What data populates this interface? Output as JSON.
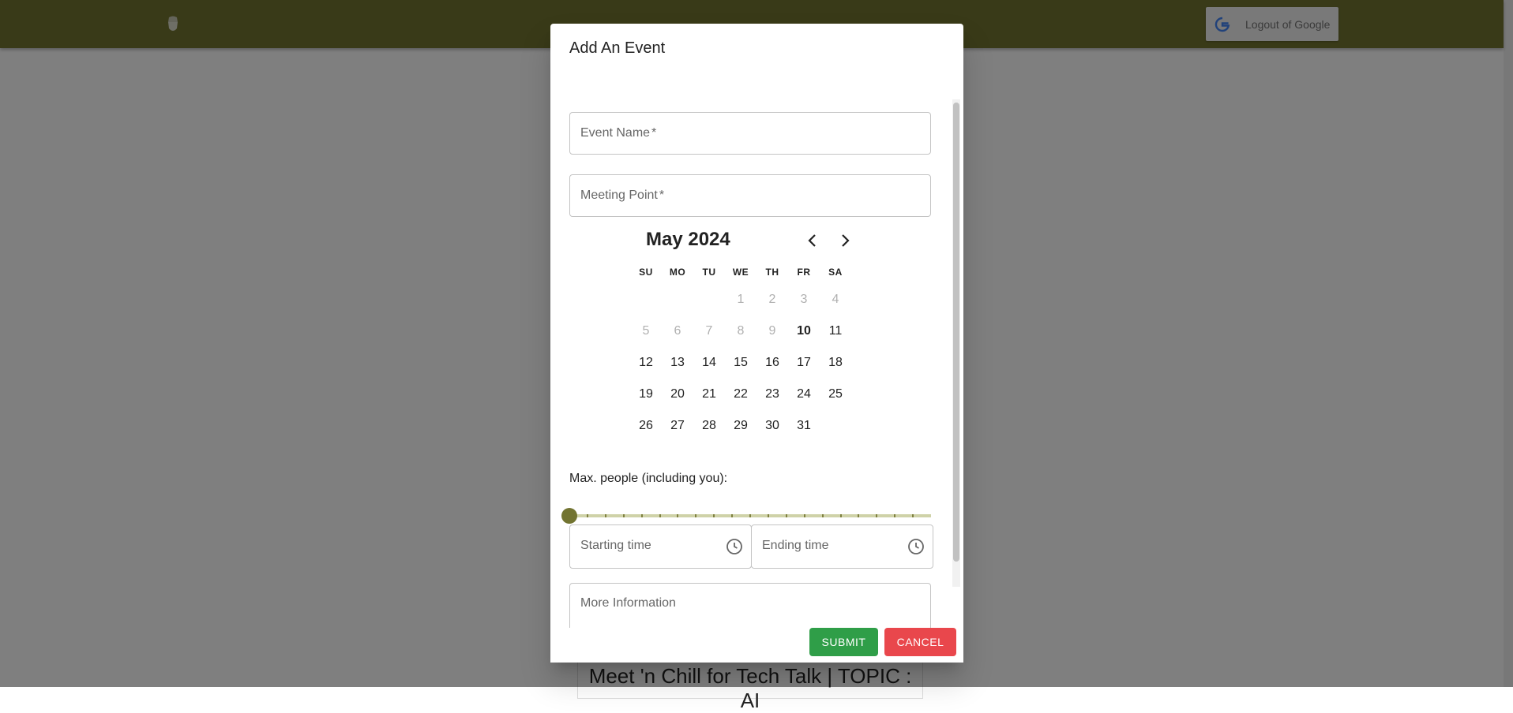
{
  "header": {
    "logo_icon": "acorn-icon",
    "logout_label": "Logout of Google",
    "logout_icon": "google-g-icon",
    "bar_color": "#727431"
  },
  "background": {
    "event_title": "Meet 'n Chill for Tech Talk | TOPIC : AI"
  },
  "dialog": {
    "title": "Add An Event",
    "event_name_placeholder": "Event Name",
    "meeting_point_placeholder": "Meeting Point",
    "required_mark": "*",
    "calendar": {
      "month_label": "May 2024",
      "prev_icon": "chevron-left-icon",
      "next_icon": "chevron-right-icon",
      "weekdays": [
        "SU",
        "MO",
        "TU",
        "WE",
        "TH",
        "FR",
        "SA"
      ],
      "first_weekday_index": 3,
      "days_in_month": 31,
      "disabled_before": 10,
      "today": 10
    },
    "max_people_label": "Max. people (including you):",
    "max_people_value": 0,
    "slider_steps": 20,
    "starting_time_placeholder": "Starting time",
    "ending_time_placeholder": "Ending time",
    "clock_icon": "clock-icon",
    "more_info_placeholder": "More Information",
    "submit_label": "SUBMIT",
    "cancel_label": "CANCEL",
    "submit_color": "#2f9e48",
    "cancel_color": "#e9474c"
  }
}
